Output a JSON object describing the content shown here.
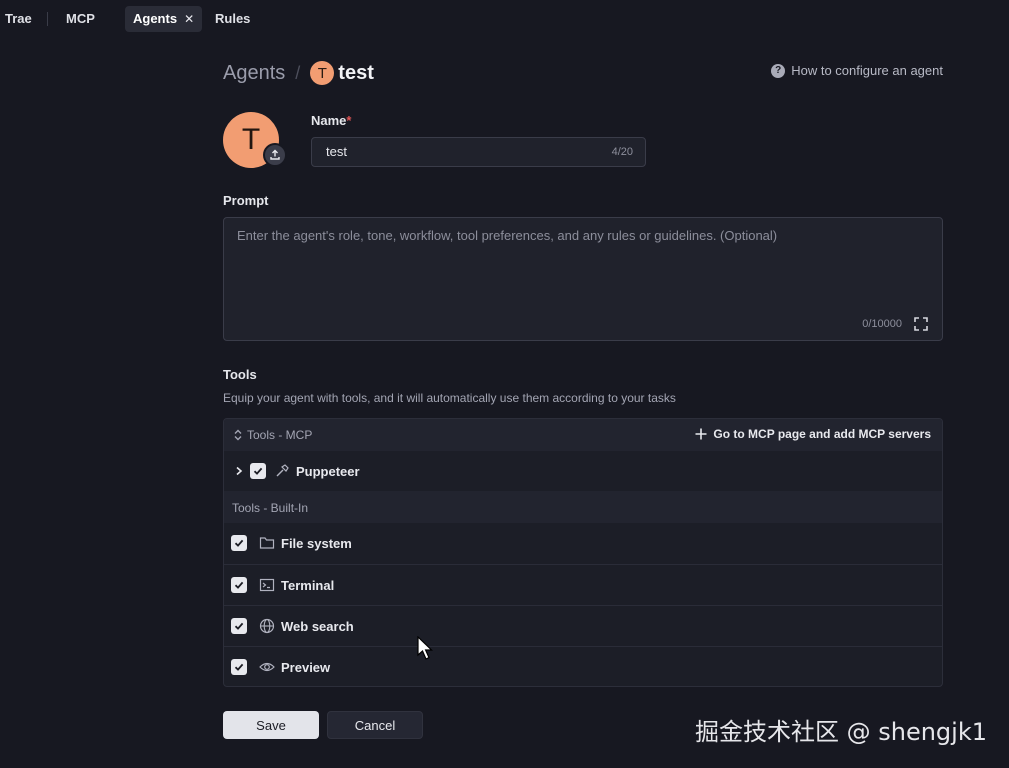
{
  "tabs": [
    {
      "label": "Trae"
    },
    {
      "label": "MCP"
    },
    {
      "label": "Agents",
      "active": true
    },
    {
      "label": "Rules"
    }
  ],
  "breadcrumb": {
    "parent": "Agents",
    "avatar_letter": "T",
    "current": "test"
  },
  "help_link": "How to configure an agent",
  "avatar": {
    "letter": "T",
    "color": "#f29d72"
  },
  "name_field": {
    "label": "Name",
    "required_mark": "*",
    "value": "test",
    "count": "4/20"
  },
  "prompt_field": {
    "label": "Prompt",
    "placeholder": "Enter the agent's role, tone, workflow, tool preferences, and any rules or guidelines. (Optional)",
    "count": "0/10000"
  },
  "tools": {
    "title": "Tools",
    "subtitle": "Equip your agent with tools, and it will automatically use them according to your tasks",
    "mcp_header": "Tools - MCP",
    "add_mcp": "Go to MCP page and add MCP servers",
    "mcp_items": [
      {
        "name": "Puppeteer",
        "checked": true
      }
    ],
    "builtin_header": "Tools - Built-In",
    "builtin_items": [
      {
        "name": "File system",
        "icon": "folder-icon",
        "checked": true
      },
      {
        "name": "Terminal",
        "icon": "terminal-icon",
        "checked": true
      },
      {
        "name": "Web search",
        "icon": "globe-icon",
        "checked": true
      },
      {
        "name": "Preview",
        "icon": "eye-icon",
        "checked": true
      }
    ]
  },
  "actions": {
    "save": "Save",
    "cancel": "Cancel"
  },
  "watermark": "掘金技术社区 @ shengjk1"
}
